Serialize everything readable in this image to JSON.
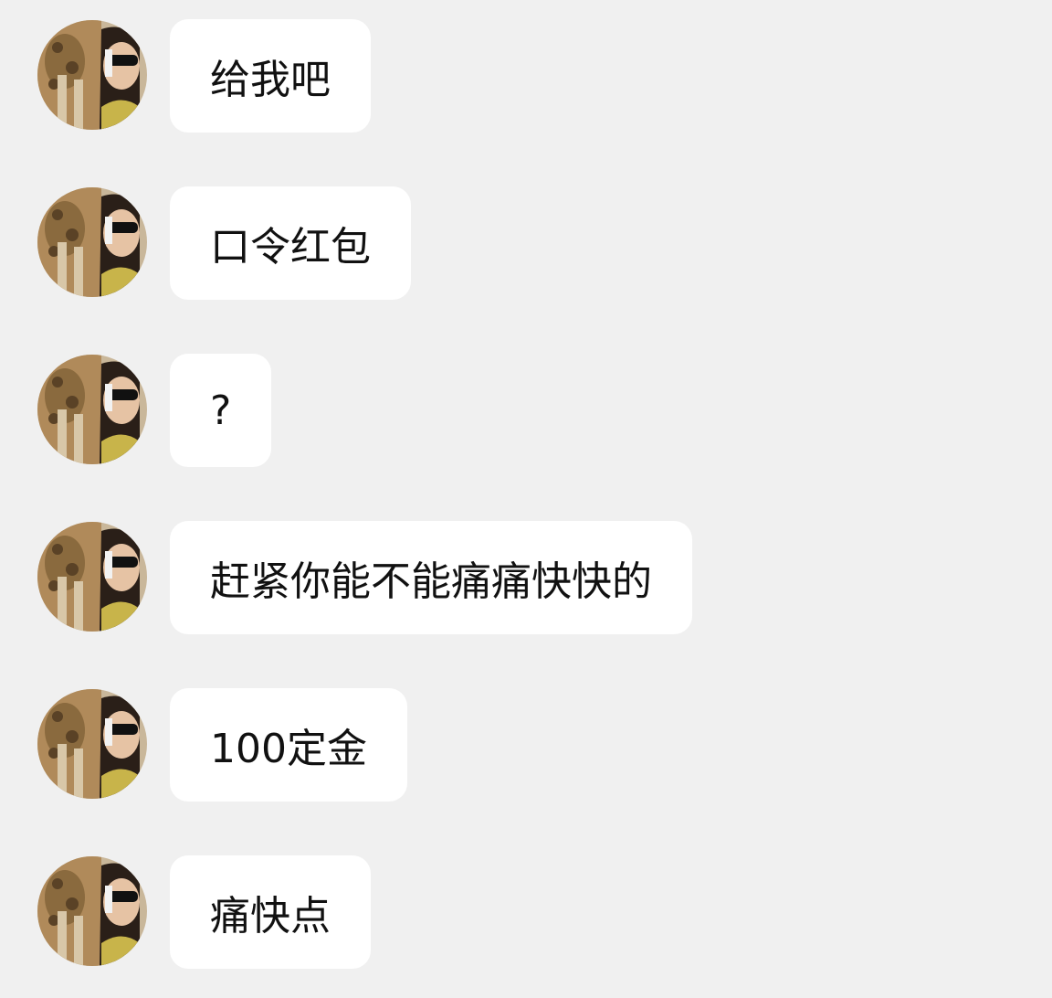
{
  "conversation": {
    "messages": [
      {
        "sender": "contact",
        "text": "给我吧",
        "avatar": "contact-avatar-photo"
      },
      {
        "sender": "contact",
        "text": "口令红包",
        "avatar": "contact-avatar-photo"
      },
      {
        "sender": "contact",
        "text": "?",
        "avatar": "contact-avatar-photo"
      },
      {
        "sender": "contact",
        "text": "赶紧你能不能痛痛快快的",
        "avatar": "contact-avatar-photo"
      },
      {
        "sender": "contact",
        "text": "100定金",
        "avatar": "contact-avatar-photo"
      },
      {
        "sender": "contact",
        "text": "痛快点",
        "avatar": "contact-avatar-photo"
      }
    ]
  },
  "colors": {
    "background": "#f0f0f0",
    "bubble": "#ffffff",
    "text": "#111111"
  }
}
